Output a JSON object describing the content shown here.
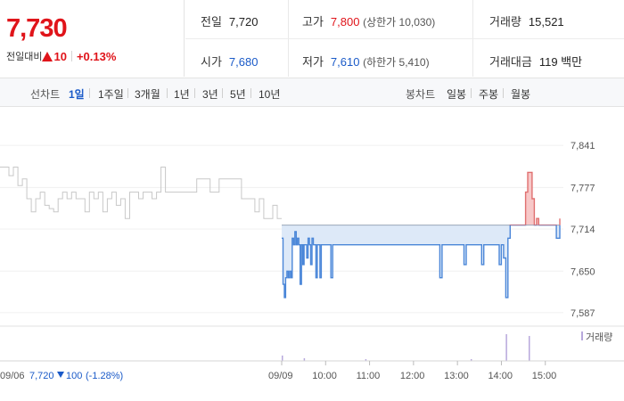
{
  "quote": {
    "price": "7,730",
    "change_label": "전일대비",
    "change_amount": "10",
    "change_rate": "+0.13%"
  },
  "stats": {
    "prev_close": {
      "label": "전일",
      "value": "7,720"
    },
    "high": {
      "label": "고가",
      "value": "7,800",
      "sub": "(상한가 10,030)"
    },
    "volume": {
      "label": "거래량",
      "value": "15,521"
    },
    "open": {
      "label": "시가",
      "value": "7,680"
    },
    "low": {
      "label": "저가",
      "value": "7,610",
      "sub": "(하한가 5,410)"
    },
    "amount": {
      "label": "거래대금",
      "value": "119 백만"
    }
  },
  "line_chart_group": {
    "label": "선차트",
    "items": [
      "1일",
      "1주일",
      "3개월",
      "1년",
      "3년",
      "5년",
      "10년"
    ],
    "active": "1일"
  },
  "candle_chart_group": {
    "label": "봉차트",
    "items": [
      "일봉",
      "주봉",
      "월봉"
    ]
  },
  "colors": {
    "up": "#e0141a",
    "down": "#1a5ac8",
    "prev_day_line": "#c8c8c8",
    "today_line": "#4a86d8",
    "fill_below": "#dde9f8",
    "fill_above": "#f7c8c8",
    "volume_bar": "#b7a8dc"
  },
  "chart_data": {
    "type": "line",
    "yticks": [
      "7,841",
      "7,777",
      "7,714",
      "7,650",
      "7,587"
    ],
    "ytick_values": [
      7841,
      7777,
      7714,
      7650,
      7587
    ],
    "ylim": [
      7576,
      7852
    ],
    "baseline": 7720,
    "xticks": [
      "09/09",
      "10:00",
      "11:00",
      "12:00",
      "13:00",
      "14:00",
      "15:00"
    ],
    "xtick_times": [
      9.0,
      10.0,
      11.0,
      12.0,
      13.0,
      14.0,
      15.0
    ],
    "prev_day_label": "09/06",
    "prev_day_summary": {
      "close": "7,720",
      "change": "100",
      "rate": "(-1.28%)"
    },
    "volume_legend": "거래량",
    "prev_day_series": [
      [
        0,
        7808
      ],
      [
        1,
        7808
      ],
      [
        2,
        7795
      ],
      [
        3,
        7808
      ],
      [
        4,
        7780
      ],
      [
        5,
        7790
      ],
      [
        6,
        7760
      ],
      [
        7,
        7740
      ],
      [
        8,
        7760
      ],
      [
        9,
        7770
      ],
      [
        10,
        7750
      ],
      [
        11,
        7745
      ],
      [
        12,
        7740
      ],
      [
        13,
        7760
      ],
      [
        14,
        7770
      ],
      [
        15,
        7760
      ],
      [
        16,
        7770
      ],
      [
        17,
        7760
      ],
      [
        18,
        7760
      ],
      [
        19,
        7740
      ],
      [
        20,
        7770
      ],
      [
        21,
        7760
      ],
      [
        22,
        7770
      ],
      [
        23,
        7740
      ],
      [
        24,
        7760
      ],
      [
        25,
        7770
      ],
      [
        26,
        7750
      ],
      [
        27,
        7760
      ],
      [
        28,
        7730
      ],
      [
        29,
        7770
      ],
      [
        30,
        7770
      ],
      [
        31,
        7760
      ],
      [
        32,
        7770
      ],
      [
        33,
        7770
      ],
      [
        34,
        7760
      ],
      [
        35,
        7770
      ],
      [
        36,
        7808
      ],
      [
        37,
        7770
      ],
      [
        38,
        7770
      ],
      [
        39,
        7770
      ],
      [
        40,
        7770
      ],
      [
        41,
        7770
      ],
      [
        42,
        7770
      ],
      [
        43,
        7770
      ],
      [
        44,
        7790
      ],
      [
        45,
        7790
      ],
      [
        46,
        7790
      ],
      [
        47,
        7770
      ],
      [
        48,
        7770
      ],
      [
        49,
        7790
      ],
      [
        50,
        7790
      ],
      [
        51,
        7790
      ],
      [
        52,
        7790
      ],
      [
        53,
        7790
      ],
      [
        54,
        7760
      ],
      [
        55,
        7760
      ],
      [
        56,
        7760
      ],
      [
        57,
        7740
      ],
      [
        58,
        7760
      ],
      [
        59,
        7730
      ],
      [
        60,
        7730
      ],
      [
        61,
        7750
      ],
      [
        62,
        7730
      ],
      [
        63,
        7730
      ]
    ],
    "today_series": [
      [
        9.0,
        7700
      ],
      [
        9.03,
        7630
      ],
      [
        9.06,
        7610
      ],
      [
        9.09,
        7640
      ],
      [
        9.12,
        7650
      ],
      [
        9.15,
        7640
      ],
      [
        9.18,
        7650
      ],
      [
        9.21,
        7640
      ],
      [
        9.24,
        7700
      ],
      [
        9.27,
        7690
      ],
      [
        9.3,
        7710
      ],
      [
        9.33,
        7690
      ],
      [
        9.36,
        7700
      ],
      [
        9.39,
        7690
      ],
      [
        9.42,
        7630
      ],
      [
        9.45,
        7690
      ],
      [
        9.48,
        7660
      ],
      [
        9.51,
        7690
      ],
      [
        9.54,
        7690
      ],
      [
        9.57,
        7670
      ],
      [
        9.6,
        7700
      ],
      [
        9.63,
        7690
      ],
      [
        9.66,
        7660
      ],
      [
        9.69,
        7700
      ],
      [
        9.72,
        7690
      ],
      [
        9.75,
        7690
      ],
      [
        9.78,
        7640
      ],
      [
        9.81,
        7690
      ],
      [
        9.84,
        7690
      ],
      [
        9.87,
        7640
      ],
      [
        9.9,
        7690
      ],
      [
        9.93,
        7690
      ],
      [
        9.96,
        7690
      ],
      [
        10.0,
        7690
      ],
      [
        10.08,
        7690
      ],
      [
        10.12,
        7640
      ],
      [
        10.16,
        7690
      ],
      [
        10.25,
        7690
      ],
      [
        10.35,
        7690
      ],
      [
        10.45,
        7690
      ],
      [
        10.55,
        7690
      ],
      [
        10.65,
        7690
      ],
      [
        10.75,
        7690
      ],
      [
        10.85,
        7690
      ],
      [
        10.95,
        7690
      ],
      [
        11.05,
        7690
      ],
      [
        11.15,
        7690
      ],
      [
        11.25,
        7690
      ],
      [
        11.35,
        7690
      ],
      [
        11.45,
        7690
      ],
      [
        11.55,
        7690
      ],
      [
        11.65,
        7690
      ],
      [
        11.75,
        7690
      ],
      [
        11.85,
        7690
      ],
      [
        11.95,
        7690
      ],
      [
        12.05,
        7690
      ],
      [
        12.15,
        7690
      ],
      [
        12.25,
        7690
      ],
      [
        12.35,
        7690
      ],
      [
        12.45,
        7690
      ],
      [
        12.55,
        7690
      ],
      [
        12.6,
        7640
      ],
      [
        12.65,
        7690
      ],
      [
        12.75,
        7690
      ],
      [
        12.85,
        7690
      ],
      [
        12.95,
        7690
      ],
      [
        13.05,
        7690
      ],
      [
        13.15,
        7660
      ],
      [
        13.2,
        7690
      ],
      [
        13.3,
        7690
      ],
      [
        13.4,
        7690
      ],
      [
        13.5,
        7690
      ],
      [
        13.55,
        7660
      ],
      [
        13.6,
        7690
      ],
      [
        13.7,
        7690
      ],
      [
        13.8,
        7690
      ],
      [
        13.9,
        7690
      ],
      [
        13.95,
        7660
      ],
      [
        14.0,
        7690
      ],
      [
        14.05,
        7670
      ],
      [
        14.1,
        7610
      ],
      [
        14.15,
        7700
      ],
      [
        14.2,
        7720
      ],
      [
        14.3,
        7720
      ],
      [
        14.4,
        7720
      ],
      [
        14.5,
        7720
      ],
      [
        14.55,
        7770
      ],
      [
        14.6,
        7800
      ],
      [
        14.65,
        7800
      ],
      [
        14.7,
        7760
      ],
      [
        14.75,
        7720
      ],
      [
        14.8,
        7730
      ],
      [
        14.85,
        7720
      ],
      [
        14.9,
        7720
      ],
      [
        14.95,
        7720
      ],
      [
        15.0,
        7720
      ],
      [
        15.05,
        7720
      ],
      [
        15.1,
        7720
      ],
      [
        15.15,
        7720
      ],
      [
        15.2,
        7720
      ],
      [
        15.25,
        7700
      ],
      [
        15.3,
        7700
      ],
      [
        15.33,
        7730
      ]
    ]
  }
}
